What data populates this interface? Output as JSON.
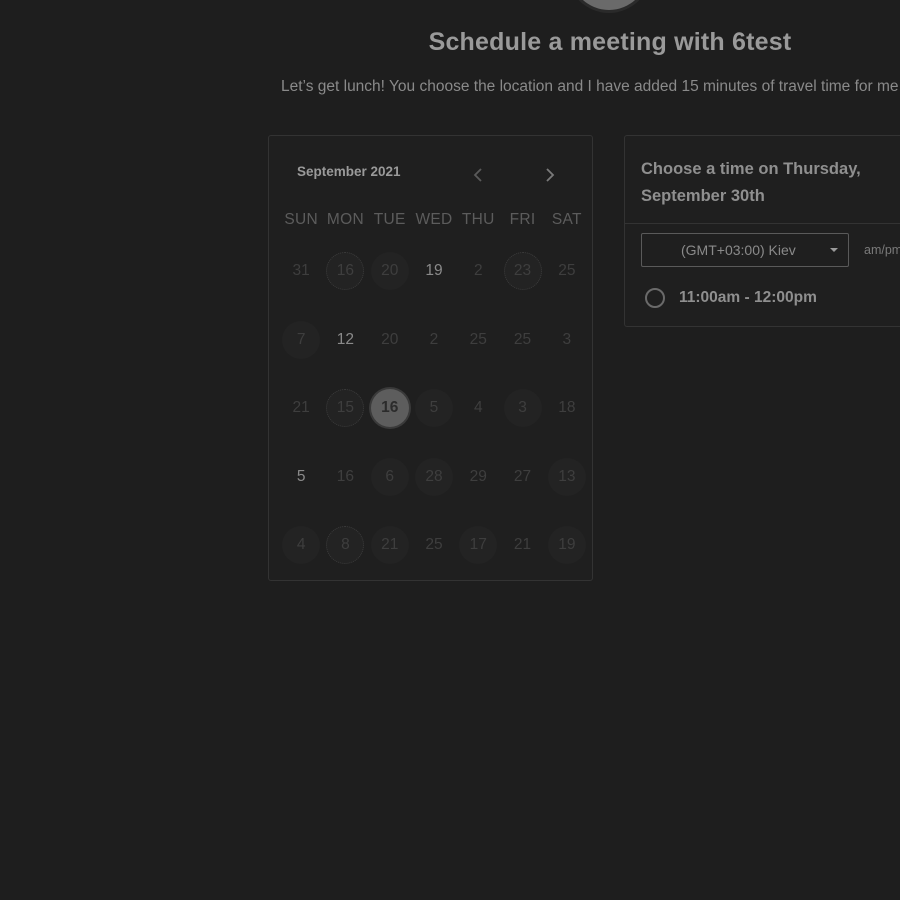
{
  "header": {
    "title": "Schedule a meeting with 6test",
    "description": "Let’s get lunch! You choose the location and I have added 15 minutes of travel time for me"
  },
  "calendar": {
    "month_label": "September 2021",
    "prev_icon": "chevron-left-icon",
    "next_icon": "chevron-right-icon",
    "weekdays": [
      "SUN",
      "MON",
      "TUE",
      "WED",
      "THU",
      "FRI",
      "SAT"
    ],
    "weeks": [
      [
        {
          "label": "31",
          "style": "plain"
        },
        {
          "label": "16",
          "style": "ring"
        },
        {
          "label": "20",
          "style": "bg"
        },
        {
          "label": "19",
          "style": "available"
        },
        {
          "label": "2",
          "style": "plain"
        },
        {
          "label": "23",
          "style": "ring"
        },
        {
          "label": "25",
          "style": "plain"
        }
      ],
      [
        {
          "label": "7",
          "style": "bg"
        },
        {
          "label": "12",
          "style": "available"
        },
        {
          "label": "20",
          "style": "plain"
        },
        {
          "label": "2",
          "style": "plain"
        },
        {
          "label": "25",
          "style": "plain"
        },
        {
          "label": "25",
          "style": "plain"
        },
        {
          "label": "3",
          "style": "plain"
        }
      ],
      [
        {
          "label": "21",
          "style": "plain"
        },
        {
          "label": "15",
          "style": "ring"
        },
        {
          "label": "16",
          "style": "selected"
        },
        {
          "label": "5",
          "style": "bg"
        },
        {
          "label": "4",
          "style": "plain"
        },
        {
          "label": "3",
          "style": "bg"
        },
        {
          "label": "18",
          "style": "plain"
        }
      ],
      [
        {
          "label": "5",
          "style": "available"
        },
        {
          "label": "16",
          "style": "plain"
        },
        {
          "label": "6",
          "style": "bg"
        },
        {
          "label": "28",
          "style": "bg"
        },
        {
          "label": "29",
          "style": "plain"
        },
        {
          "label": "27",
          "style": "plain"
        },
        {
          "label": "13",
          "style": "bg"
        }
      ],
      [
        {
          "label": "4",
          "style": "bg"
        },
        {
          "label": "8",
          "style": "ring"
        },
        {
          "label": "21",
          "style": "bg"
        },
        {
          "label": "25",
          "style": "plain"
        },
        {
          "label": "17",
          "style": "bg"
        },
        {
          "label": "21",
          "style": "plain"
        },
        {
          "label": "19",
          "style": "bg"
        }
      ]
    ]
  },
  "time_picker": {
    "heading": "Choose a time on Thursday, September 30th",
    "timezone": "(GMT+03:00) Kiev",
    "format_label": "am/pm",
    "slots": [
      {
        "label": "11:00am - 12:00pm"
      }
    ]
  },
  "colors": {
    "background": "#1e1e1e",
    "selected_day": "#5d5d5d"
  }
}
